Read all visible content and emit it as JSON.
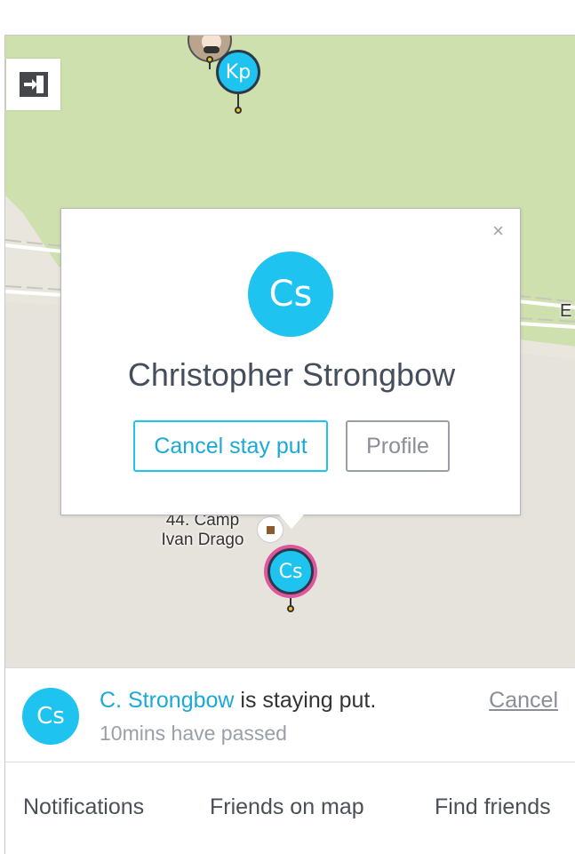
{
  "map": {
    "markers": [
      {
        "initials": "Kp"
      },
      {
        "initials": "Cs"
      }
    ],
    "place_label_line1": "44. Camp",
    "place_label_line2": "Ivan Drago",
    "road_label": "E",
    "colors": {
      "park": "#cde0ad",
      "ground": "#e6e3dc",
      "accent": "#1fc3ef",
      "highlight_ring": "#e0559c"
    }
  },
  "popup": {
    "initials": "Cs",
    "name": "Christopher Strongbow",
    "close_glyph": "×",
    "cancel_stay_put_label": "Cancel stay put",
    "profile_label": "Profile"
  },
  "status": {
    "initials": "Cs",
    "name": "C. Strongbow",
    "message": " is staying put.",
    "elapsed": "10mins have passed",
    "cancel_label": "Cancel"
  },
  "tabs": [
    {
      "label": "Notifications"
    },
    {
      "label": "Friends on map"
    },
    {
      "label": "Find friends"
    }
  ],
  "icons": {
    "exit": "exit-arrow-icon",
    "poi": "poi-icon",
    "close": "close-icon"
  }
}
